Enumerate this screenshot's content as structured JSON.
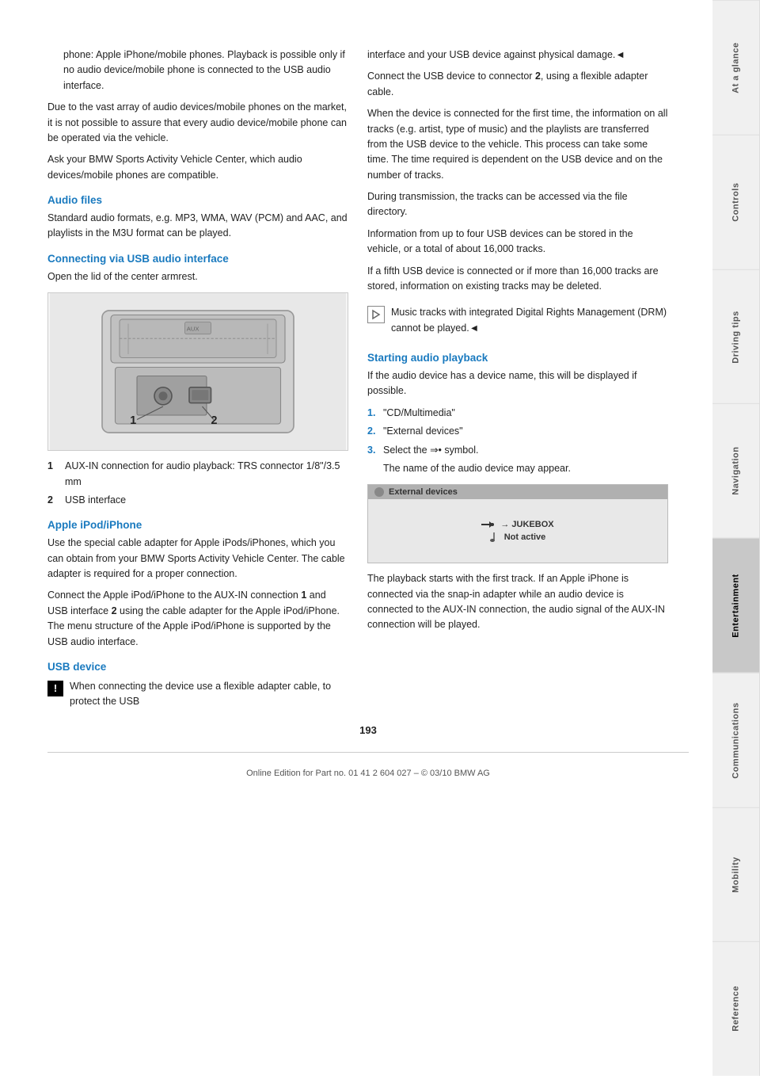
{
  "page": {
    "number": "193",
    "footer": "Online Edition for Part no. 01 41 2 604 027 – © 03/10 BMW AG"
  },
  "sidebar": {
    "tabs": [
      {
        "id": "at-a-glance",
        "label": "At a glance",
        "active": false
      },
      {
        "id": "controls",
        "label": "Controls",
        "active": false
      },
      {
        "id": "driving-tips",
        "label": "Driving tips",
        "active": false
      },
      {
        "id": "navigation",
        "label": "Navigation",
        "active": false
      },
      {
        "id": "entertainment",
        "label": "Entertainment",
        "active": true
      },
      {
        "id": "communications",
        "label": "Communications",
        "active": false
      },
      {
        "id": "mobility",
        "label": "Mobility",
        "active": false
      },
      {
        "id": "reference",
        "label": "Reference",
        "active": false
      }
    ]
  },
  "col_left": {
    "indented_text": "phone: Apple iPhone/mobile phones. Playback is possible only if no audio device/mobile phone is connected to the USB audio interface.",
    "body1": "Due to the vast array of audio devices/mobile phones on the market, it is not possible to assure that every audio device/mobile phone can be operated via the vehicle.",
    "body2": "Ask your BMW Sports Activity Vehicle Center, which audio devices/mobile phones are compatible.",
    "audio_files_heading": "Audio files",
    "audio_files_body": "Standard audio formats, e.g. MP3, WMA, WAV (PCM) and AAC, and playlists in the M3U format can be played.",
    "usb_heading": "Connecting via USB audio interface",
    "usb_body": "Open the lid of the center armrest.",
    "label1_num": "1",
    "label1_text": "AUX-IN connection for audio playback: TRS connector 1/8\"/3.5 mm",
    "label2_num": "2",
    "label2_text": "USB interface",
    "apple_heading": "Apple iPod/iPhone",
    "apple_body1": "Use the special cable adapter for Apple iPods/iPhones, which you can obtain from your BMW Sports Activity Vehicle Center. The cable adapter is required for a proper connection.",
    "apple_body2": "Connect the Apple iPod/iPhone to the AUX-IN connection 1 and USB interface 2 using the cable adapter for the Apple iPod/iPhone. The menu structure of the Apple iPod/iPhone is supported by the USB audio interface.",
    "usb_device_heading": "USB device",
    "warning_text": "When connecting the device use a flexible adapter cable, to protect the USB"
  },
  "col_right": {
    "body1": "interface and your USB device against physical damage.◄",
    "body2": "Connect the USB device to connector 2, using a flexible adapter cable.",
    "body3": "When the device is connected for the first time, the information on all tracks (e.g. artist, type of music) and the playlists are transferred from the USB device to the vehicle. This process can take some time. The time required is dependent on the USB device and on the number of tracks.",
    "body4": "During transmission, the tracks can be accessed via the file directory.",
    "body5": "Information from up to four USB devices can be stored in the vehicle, or a total of about 16,000 tracks.",
    "body6": "If a fifth USB device is connected or if more than 16,000 tracks are stored, information on existing tracks may be deleted.",
    "note_text": "Music tracks with integrated Digital Rights Management (DRM) cannot be played.◄",
    "starting_heading": "Starting audio playback",
    "starting_body": "If the audio device has a device name, this will be displayed if possible.",
    "item1_num": "1.",
    "item1_text": "\"CD/Multimedia\"",
    "item2_num": "2.",
    "item2_text": "\"External devices\"",
    "item3_num": "3.",
    "item3_text": "Select the ⇒• symbol.",
    "item3b": "The name of the audio device may appear.",
    "screen_title": "External devices",
    "screen_jukebox": "→ JUKEBOX",
    "screen_note": "Not active",
    "playback_body": "The playback starts with the first track. If an Apple iPhone is connected via the snap-in adapter while an audio device is connected to the AUX-IN connection, the audio signal of the AUX-IN connection will be played."
  },
  "diagram": {
    "label1": "1",
    "label2": "2"
  }
}
